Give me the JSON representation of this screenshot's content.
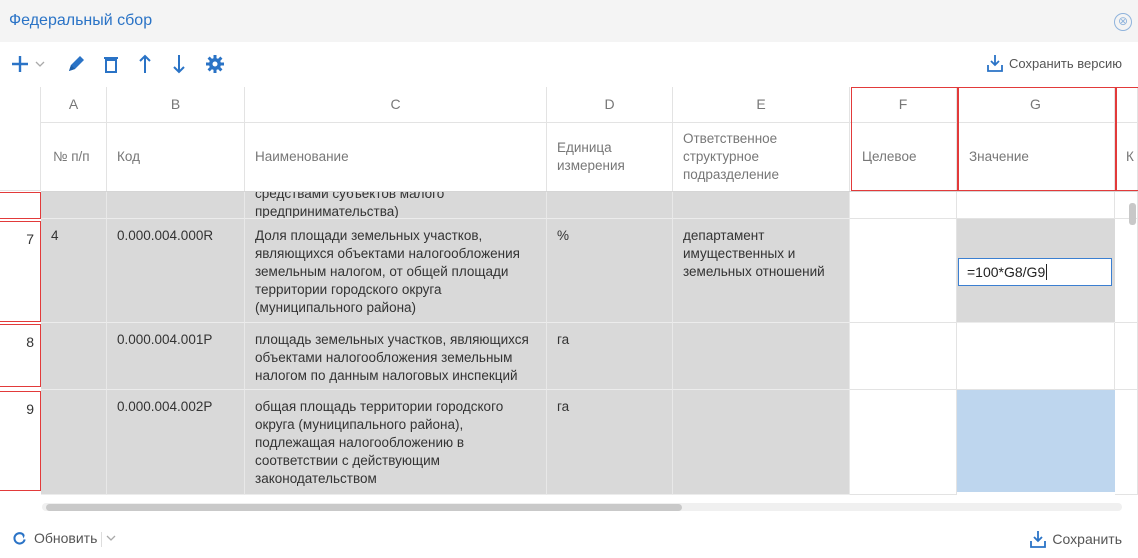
{
  "dialog": {
    "title": "Федеральный сбор",
    "close_glyph": "⊗"
  },
  "toolbar": {
    "add_icon": "plus-icon",
    "add_dropdown_icon": "chevron-down-icon",
    "edit_icon": "pencil-icon",
    "delete_icon": "trash-icon",
    "move_up_icon": "arrow-up-icon",
    "move_down_icon": "arrow-down-icon",
    "settings_icon": "gear-icon",
    "save_version_label": "Сохранить версию",
    "accent_color": "#2a73c6"
  },
  "columns": [
    {
      "letter": "A",
      "name": "№ п/п"
    },
    {
      "letter": "B",
      "name": "Код"
    },
    {
      "letter": "C",
      "name": "Наименование"
    },
    {
      "letter": "D",
      "name": "Единица измерения"
    },
    {
      "letter": "E",
      "name": "Ответственное структурное подразделение"
    },
    {
      "letter": "F",
      "name": "Целевое"
    },
    {
      "letter": "G",
      "name": "Значение"
    },
    {
      "letter": "",
      "name": "К"
    }
  ],
  "rows": [
    {
      "num": "",
      "cells": [
        "",
        "",
        "средствами субъектов малого предпринимательства)",
        "",
        ""
      ]
    },
    {
      "num": "7",
      "cells": [
        "4",
        "0.000.004.000R",
        "Доля площади земельных участков, являющихся объектами налогообложения земельным налогом, от общей площади территории городского округа (муниципального района)",
        "%",
        "департамент имущественных и земельных отношений"
      ],
      "value_formula": "=100*G8/G9"
    },
    {
      "num": "8",
      "cells": [
        "",
        "0.000.004.001Р",
        "площадь земельных участков, являющихся объектами налогообложения земельным налогом по данным налоговых инспекций",
        "га",
        ""
      ]
    },
    {
      "num": "9",
      "cells": [
        "",
        "0.000.004.002Р",
        "общая площадь территории городского округа (муниципального района), подлежащая налогообложению в соответствии с действующим законодательством",
        "га",
        ""
      ]
    }
  ],
  "footer": {
    "refresh_label": "Обновить",
    "save_label": "Сохранить"
  },
  "colors": {
    "highlight_red": "#e23a3a",
    "selected_cell": "#bed6ee",
    "readonly_gray": "#d9d9d9"
  }
}
